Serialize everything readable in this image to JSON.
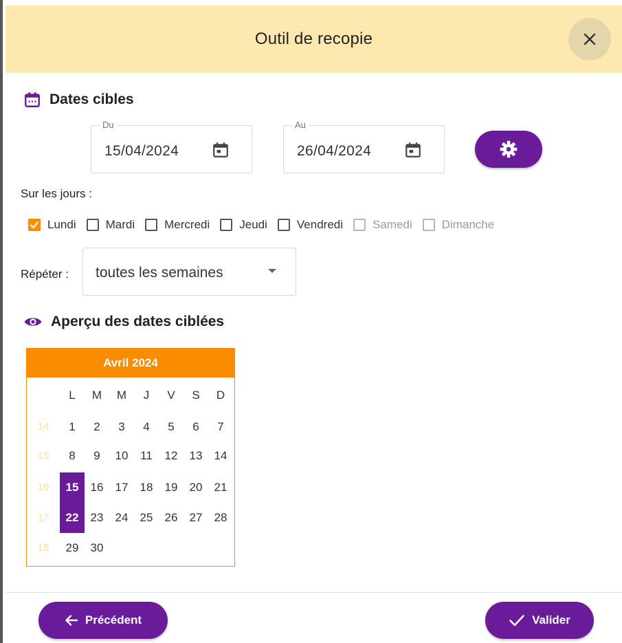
{
  "dialog": {
    "title": "Outil de recopie",
    "close_icon": "close-icon"
  },
  "target_dates": {
    "title": "Dates cibles",
    "icon": "calendar-icon",
    "from": {
      "label": "Du",
      "value": "15/04/2024"
    },
    "to": {
      "label": "Au",
      "value": "26/04/2024"
    },
    "settings_icon": "gear-icon"
  },
  "days": {
    "label": "Sur les jours :",
    "items": [
      {
        "label": "Lundi",
        "checked": true,
        "disabled": false
      },
      {
        "label": "Mardi",
        "checked": false,
        "disabled": false
      },
      {
        "label": "Mercredi",
        "checked": false,
        "disabled": false
      },
      {
        "label": "Jeudi",
        "checked": false,
        "disabled": false
      },
      {
        "label": "Vendredi",
        "checked": false,
        "disabled": false
      },
      {
        "label": "Samedi",
        "checked": false,
        "disabled": true
      },
      {
        "label": "Dimanche",
        "checked": false,
        "disabled": true
      }
    ]
  },
  "repeat": {
    "label": "Répéter :",
    "value": "toutes les semaines"
  },
  "preview": {
    "title": "Aperçu des dates ciblées",
    "icon": "eye-icon",
    "calendar": {
      "month": "Avril 2024",
      "weekdays": [
        "L",
        "M",
        "M",
        "J",
        "V",
        "S",
        "D"
      ],
      "weeks": [
        {
          "number": "14",
          "days": [
            "1",
            "2",
            "3",
            "4",
            "5",
            "6",
            "7"
          ]
        },
        {
          "number": "15",
          "days": [
            "8",
            "9",
            "10",
            "11",
            "12",
            "13",
            "14"
          ]
        },
        {
          "number": "16",
          "days": [
            "15",
            "16",
            "17",
            "18",
            "19",
            "20",
            "21"
          ]
        },
        {
          "number": "17",
          "days": [
            "22",
            "23",
            "24",
            "25",
            "26",
            "27",
            "28"
          ]
        },
        {
          "number": "18",
          "days": [
            "29",
            "30"
          ]
        }
      ],
      "selected": [
        "15",
        "22"
      ]
    }
  },
  "footer": {
    "previous_label": "Précédent",
    "validate_label": "Valider"
  },
  "colors": {
    "header_bg": "#fde8b0",
    "accent_purple": "#6a1b9a",
    "accent_orange": "#fb8c00"
  }
}
